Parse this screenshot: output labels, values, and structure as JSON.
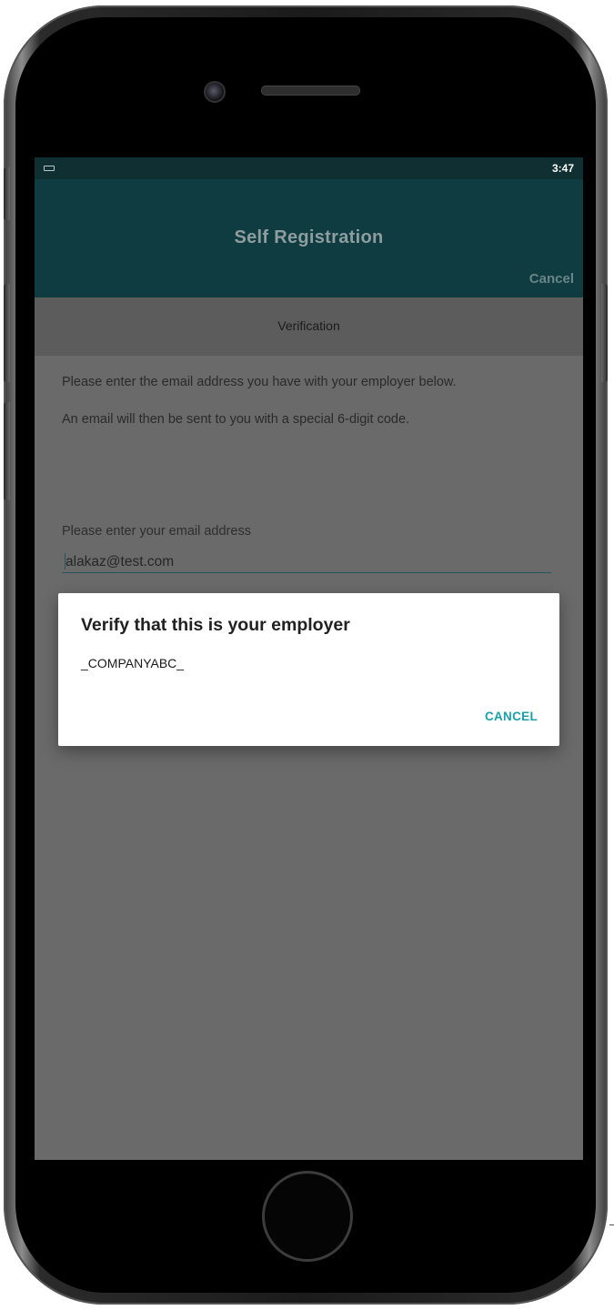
{
  "status_bar": {
    "notification_icon": "keyboard-icon",
    "time": "3:47"
  },
  "app_bar": {
    "title": "Self Registration",
    "cancel_label": "Cancel"
  },
  "section": {
    "title": "Verification"
  },
  "instructions": {
    "line1": "Please enter the email address you have with your employer below.",
    "line2": "An email will then be sent to you with a special 6-digit code."
  },
  "email": {
    "label": "Please enter your email address",
    "value": "alakaz@test.com"
  },
  "dialog": {
    "title": "Verify that this is your employer",
    "company": "_COMPANYABC_",
    "cancel_label": "CANCEL"
  },
  "colors": {
    "app_bar": "#0e3c40",
    "status_bar": "#0f2f32",
    "accent": "#1ba0a8",
    "scrim_background": "#6a6a6a"
  }
}
